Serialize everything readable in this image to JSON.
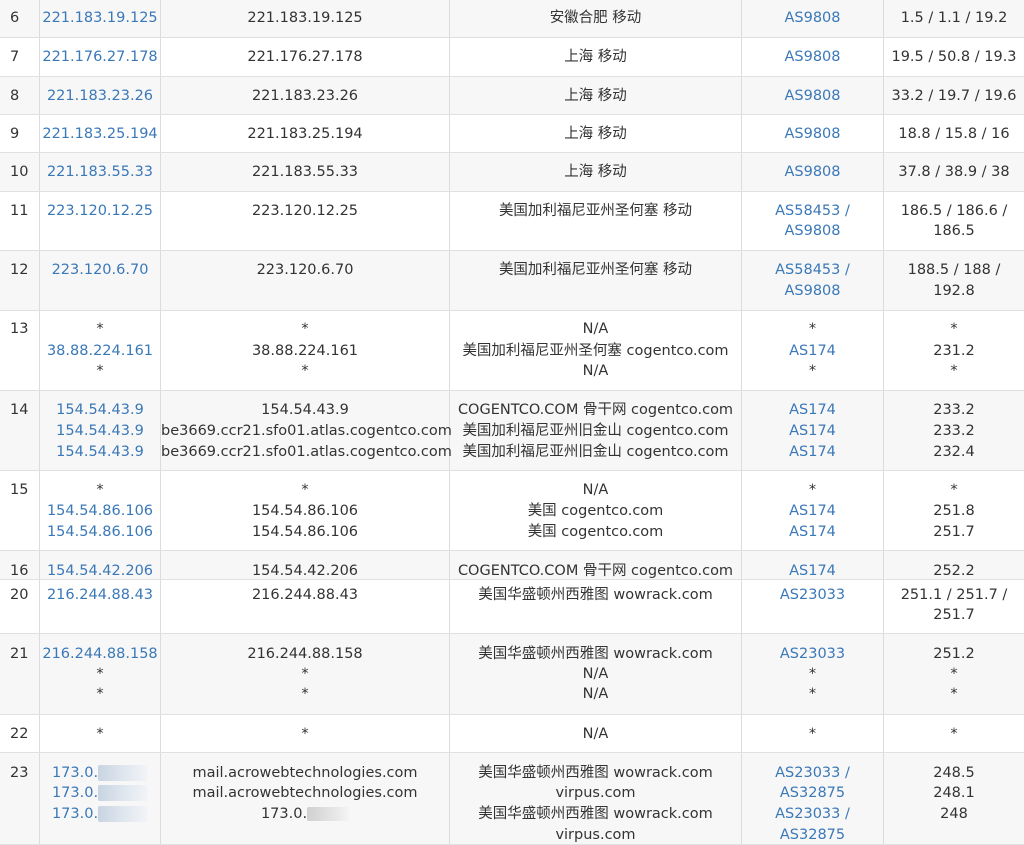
{
  "colors": {
    "link": "#3a78b8",
    "text": "#333333",
    "row_alt": "#f7f7f7",
    "border": "#dcdcdc"
  },
  "rows": [
    {
      "hop": "6",
      "ip": [
        "221.183.19.125"
      ],
      "host": [
        "221.183.19.125"
      ],
      "loc": [
        "安徽合肥 移动"
      ],
      "asn": [
        "AS9808"
      ],
      "rtt": [
        "1.5 / 1.1 / 19.2"
      ]
    },
    {
      "hop": "7",
      "ip": [
        "221.176.27.178"
      ],
      "host": [
        "221.176.27.178"
      ],
      "loc": [
        "上海 移动"
      ],
      "asn": [
        "AS9808"
      ],
      "rtt": [
        "19.5 / 50.8 / 19.3"
      ]
    },
    {
      "hop": "8",
      "ip": [
        "221.183.23.26"
      ],
      "host": [
        "221.183.23.26"
      ],
      "loc": [
        "上海 移动"
      ],
      "asn": [
        "AS9808"
      ],
      "rtt": [
        "33.2 / 19.7 / 19.6"
      ]
    },
    {
      "hop": "9",
      "ip": [
        "221.183.25.194"
      ],
      "host": [
        "221.183.25.194"
      ],
      "loc": [
        "上海 移动"
      ],
      "asn": [
        "AS9808"
      ],
      "rtt": [
        "18.8 / 15.8 / 16"
      ]
    },
    {
      "hop": "10",
      "ip": [
        "221.183.55.33"
      ],
      "host": [
        "221.183.55.33"
      ],
      "loc": [
        "上海 移动"
      ],
      "asn": [
        "AS9808"
      ],
      "rtt": [
        "37.8 / 38.9 / 38"
      ]
    },
    {
      "hop": "11",
      "ip": [
        "223.120.12.25"
      ],
      "host": [
        "223.120.12.25"
      ],
      "loc": [
        "美国加利福尼亚州圣何塞 移动"
      ],
      "asn": [
        "AS58453 /",
        "AS9808"
      ],
      "rtt": [
        "186.5 / 186.6 /",
        "186.5"
      ]
    },
    {
      "hop": "12",
      "ip": [
        "223.120.6.70"
      ],
      "host": [
        "223.120.6.70"
      ],
      "loc": [
        "美国加利福尼亚州圣何塞 移动"
      ],
      "asn": [
        "AS58453 /",
        "AS9808"
      ],
      "rtt": [
        "188.5 / 188 /",
        "192.8"
      ]
    },
    {
      "hop": "13",
      "ip": [
        "*",
        "38.88.224.161",
        "*"
      ],
      "host": [
        "*",
        "38.88.224.161",
        "*"
      ],
      "loc": [
        "N/A",
        "美国加利福尼亚州圣何塞 cogentco.com",
        "N/A"
      ],
      "asn": [
        "*",
        "AS174",
        "*"
      ],
      "rtt": [
        "*",
        "231.2",
        "*"
      ]
    },
    {
      "hop": "14",
      "ip": [
        "154.54.43.9",
        "154.54.43.9",
        "154.54.43.9"
      ],
      "host": [
        "154.54.43.9",
        "be3669.ccr21.sfo01.atlas.cogentco.com",
        "be3669.ccr21.sfo01.atlas.cogentco.com"
      ],
      "loc": [
        "COGENTCO.COM 骨干网 cogentco.com",
        "美国加利福尼亚州旧金山 cogentco.com",
        "美国加利福尼亚州旧金山 cogentco.com"
      ],
      "asn": [
        "AS174",
        "AS174",
        "AS174"
      ],
      "rtt": [
        "233.2",
        "233.2",
        "232.4"
      ]
    },
    {
      "hop": "15",
      "ip": [
        "*",
        "154.54.86.106",
        "154.54.86.106"
      ],
      "host": [
        "*",
        "154.54.86.106",
        "154.54.86.106"
      ],
      "loc": [
        "N/A",
        "美国 cogentco.com",
        "美国 cogentco.com"
      ],
      "asn": [
        "*",
        "AS174",
        "AS174"
      ],
      "rtt": [
        "*",
        "251.8",
        "251.7"
      ]
    },
    {
      "hop": "16",
      "ip": [
        "154.54.42.206"
      ],
      "host": [
        "154.54.42.206"
      ],
      "loc": [
        "COGENTCO.COM 骨干网 cogentco.com"
      ],
      "asn": [
        "AS174"
      ],
      "rtt": [
        "252.2"
      ]
    },
    {
      "hop": "20",
      "ip": [
        "216.244.88.43"
      ],
      "host": [
        "216.244.88.43"
      ],
      "loc": [
        "美国华盛顿州西雅图 wowrack.com"
      ],
      "asn": [
        "AS23033"
      ],
      "rtt": [
        "251.1 / 251.7 /",
        "251.7"
      ]
    },
    {
      "hop": "21",
      "ip": [
        "216.244.88.158",
        "*",
        "*"
      ],
      "host": [
        "216.244.88.158",
        "*",
        "*"
      ],
      "loc": [
        "美国华盛顿州西雅图 wowrack.com",
        "N/A",
        "N/A"
      ],
      "asn": [
        "AS23033",
        "*",
        "*"
      ],
      "rtt": [
        "251.2",
        "*",
        "*"
      ]
    },
    {
      "hop": "22",
      "ip": [
        "*"
      ],
      "host": [
        "*"
      ],
      "loc": [
        "N/A"
      ],
      "asn": [
        "*"
      ],
      "rtt": [
        "*"
      ]
    },
    {
      "hop": "23",
      "ip": [
        "173.0.",
        "173.0.",
        "173.0."
      ],
      "host": [
        "mail.acrowebtechnologies.com",
        "mail.acrowebtechnologies.com",
        "173.0."
      ],
      "loc": [
        "美国华盛顿州西雅图 wowrack.com",
        "virpus.com",
        "美国华盛顿州西雅图 wowrack.com",
        "virpus.com"
      ],
      "asn": [
        "AS23033 /",
        "AS32875",
        "AS23033 /",
        "AS32875"
      ],
      "rtt": [
        "248.5",
        "248.1",
        "248"
      ]
    }
  ]
}
